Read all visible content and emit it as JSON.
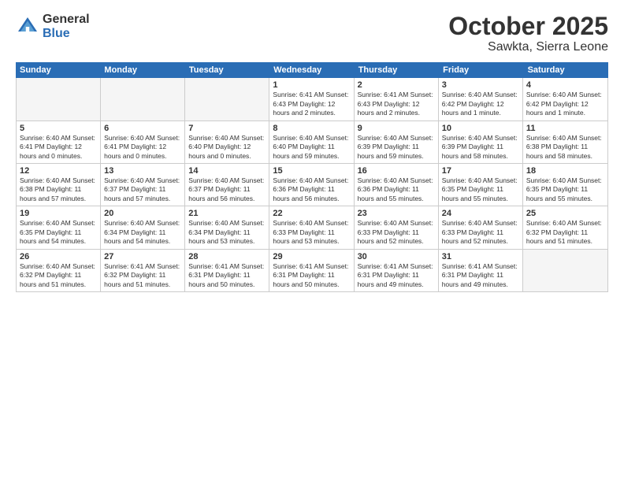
{
  "logo": {
    "general": "General",
    "blue": "Blue"
  },
  "header": {
    "month": "October 2025",
    "location": "Sawkta, Sierra Leone"
  },
  "days_of_week": [
    "Sunday",
    "Monday",
    "Tuesday",
    "Wednesday",
    "Thursday",
    "Friday",
    "Saturday"
  ],
  "weeks": [
    [
      {
        "day": "",
        "info": "",
        "empty": true
      },
      {
        "day": "",
        "info": "",
        "empty": true
      },
      {
        "day": "",
        "info": "",
        "empty": true
      },
      {
        "day": "1",
        "info": "Sunrise: 6:41 AM\nSunset: 6:43 PM\nDaylight: 12 hours\nand 2 minutes."
      },
      {
        "day": "2",
        "info": "Sunrise: 6:41 AM\nSunset: 6:43 PM\nDaylight: 12 hours\nand 2 minutes."
      },
      {
        "day": "3",
        "info": "Sunrise: 6:40 AM\nSunset: 6:42 PM\nDaylight: 12 hours\nand 1 minute."
      },
      {
        "day": "4",
        "info": "Sunrise: 6:40 AM\nSunset: 6:42 PM\nDaylight: 12 hours\nand 1 minute."
      }
    ],
    [
      {
        "day": "5",
        "info": "Sunrise: 6:40 AM\nSunset: 6:41 PM\nDaylight: 12 hours\nand 0 minutes."
      },
      {
        "day": "6",
        "info": "Sunrise: 6:40 AM\nSunset: 6:41 PM\nDaylight: 12 hours\nand 0 minutes."
      },
      {
        "day": "7",
        "info": "Sunrise: 6:40 AM\nSunset: 6:40 PM\nDaylight: 12 hours\nand 0 minutes."
      },
      {
        "day": "8",
        "info": "Sunrise: 6:40 AM\nSunset: 6:40 PM\nDaylight: 11 hours\nand 59 minutes."
      },
      {
        "day": "9",
        "info": "Sunrise: 6:40 AM\nSunset: 6:39 PM\nDaylight: 11 hours\nand 59 minutes."
      },
      {
        "day": "10",
        "info": "Sunrise: 6:40 AM\nSunset: 6:39 PM\nDaylight: 11 hours\nand 58 minutes."
      },
      {
        "day": "11",
        "info": "Sunrise: 6:40 AM\nSunset: 6:38 PM\nDaylight: 11 hours\nand 58 minutes."
      }
    ],
    [
      {
        "day": "12",
        "info": "Sunrise: 6:40 AM\nSunset: 6:38 PM\nDaylight: 11 hours\nand 57 minutes."
      },
      {
        "day": "13",
        "info": "Sunrise: 6:40 AM\nSunset: 6:37 PM\nDaylight: 11 hours\nand 57 minutes."
      },
      {
        "day": "14",
        "info": "Sunrise: 6:40 AM\nSunset: 6:37 PM\nDaylight: 11 hours\nand 56 minutes."
      },
      {
        "day": "15",
        "info": "Sunrise: 6:40 AM\nSunset: 6:36 PM\nDaylight: 11 hours\nand 56 minutes."
      },
      {
        "day": "16",
        "info": "Sunrise: 6:40 AM\nSunset: 6:36 PM\nDaylight: 11 hours\nand 55 minutes."
      },
      {
        "day": "17",
        "info": "Sunrise: 6:40 AM\nSunset: 6:35 PM\nDaylight: 11 hours\nand 55 minutes."
      },
      {
        "day": "18",
        "info": "Sunrise: 6:40 AM\nSunset: 6:35 PM\nDaylight: 11 hours\nand 55 minutes."
      }
    ],
    [
      {
        "day": "19",
        "info": "Sunrise: 6:40 AM\nSunset: 6:35 PM\nDaylight: 11 hours\nand 54 minutes."
      },
      {
        "day": "20",
        "info": "Sunrise: 6:40 AM\nSunset: 6:34 PM\nDaylight: 11 hours\nand 54 minutes."
      },
      {
        "day": "21",
        "info": "Sunrise: 6:40 AM\nSunset: 6:34 PM\nDaylight: 11 hours\nand 53 minutes."
      },
      {
        "day": "22",
        "info": "Sunrise: 6:40 AM\nSunset: 6:33 PM\nDaylight: 11 hours\nand 53 minutes."
      },
      {
        "day": "23",
        "info": "Sunrise: 6:40 AM\nSunset: 6:33 PM\nDaylight: 11 hours\nand 52 minutes."
      },
      {
        "day": "24",
        "info": "Sunrise: 6:40 AM\nSunset: 6:33 PM\nDaylight: 11 hours\nand 52 minutes."
      },
      {
        "day": "25",
        "info": "Sunrise: 6:40 AM\nSunset: 6:32 PM\nDaylight: 11 hours\nand 51 minutes."
      }
    ],
    [
      {
        "day": "26",
        "info": "Sunrise: 6:40 AM\nSunset: 6:32 PM\nDaylight: 11 hours\nand 51 minutes."
      },
      {
        "day": "27",
        "info": "Sunrise: 6:41 AM\nSunset: 6:32 PM\nDaylight: 11 hours\nand 51 minutes."
      },
      {
        "day": "28",
        "info": "Sunrise: 6:41 AM\nSunset: 6:31 PM\nDaylight: 11 hours\nand 50 minutes."
      },
      {
        "day": "29",
        "info": "Sunrise: 6:41 AM\nSunset: 6:31 PM\nDaylight: 11 hours\nand 50 minutes."
      },
      {
        "day": "30",
        "info": "Sunrise: 6:41 AM\nSunset: 6:31 PM\nDaylight: 11 hours\nand 49 minutes."
      },
      {
        "day": "31",
        "info": "Sunrise: 6:41 AM\nSunset: 6:31 PM\nDaylight: 11 hours\nand 49 minutes."
      },
      {
        "day": "",
        "info": "",
        "empty": true
      }
    ]
  ]
}
